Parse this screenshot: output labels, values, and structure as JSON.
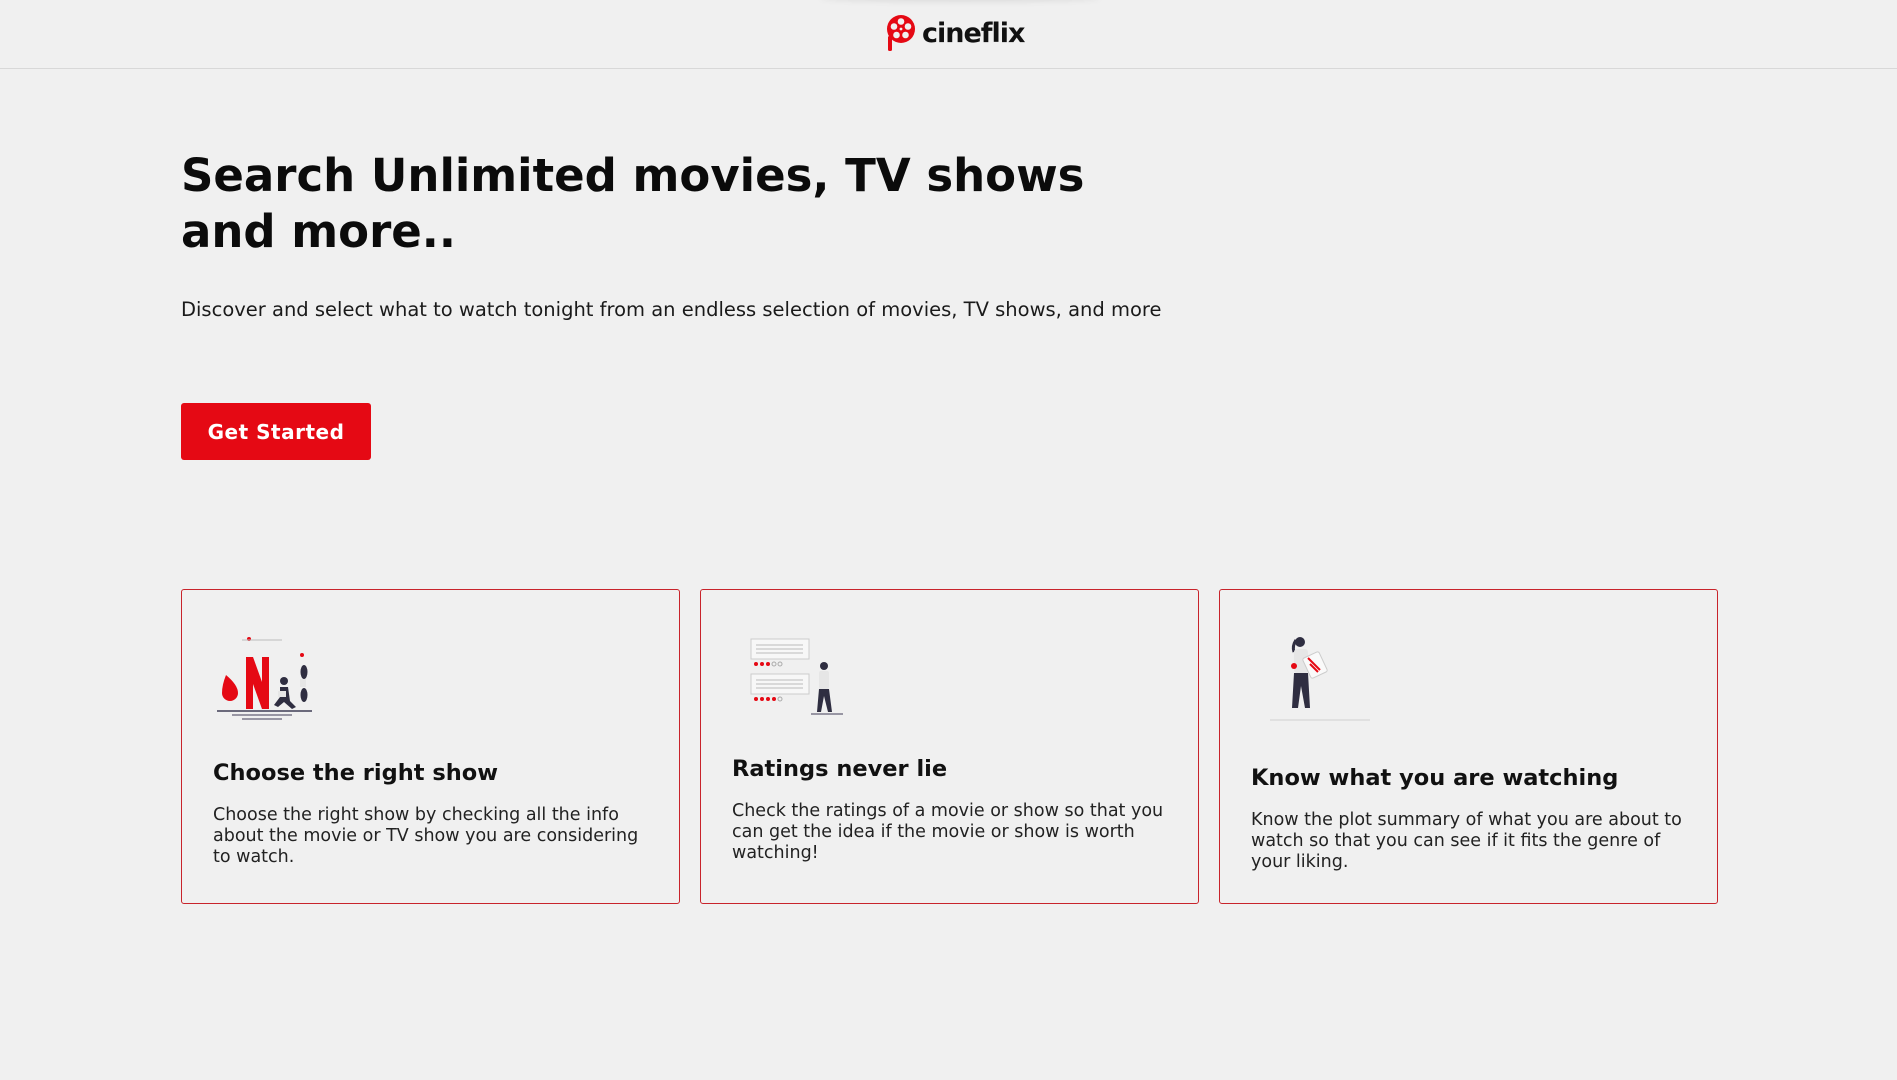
{
  "brand": {
    "name": "cineflix",
    "accent": "#e50914"
  },
  "hero": {
    "title": "Search Unlimited movies, TV shows and more..",
    "subtitle": "Discover and select what to watch tonight from an endless selection of movies, TV shows, and more",
    "cta_label": "Get Started"
  },
  "features": [
    {
      "icon": "streaming-illustration-icon",
      "title": "Choose the right show",
      "description": "Choose the right show by checking all the info about the movie or TV show you are considering to watch."
    },
    {
      "icon": "ratings-illustration-icon",
      "title": "Ratings never lie",
      "description": "Check the ratings of a movie or show so that you can get the idea if the movie or show is worth watching!"
    },
    {
      "icon": "plot-summary-illustration-icon",
      "title": "Know what you are watching",
      "description": "Know the plot summary of what you are about to watch so that you can see if it fits the genre of your liking."
    }
  ]
}
